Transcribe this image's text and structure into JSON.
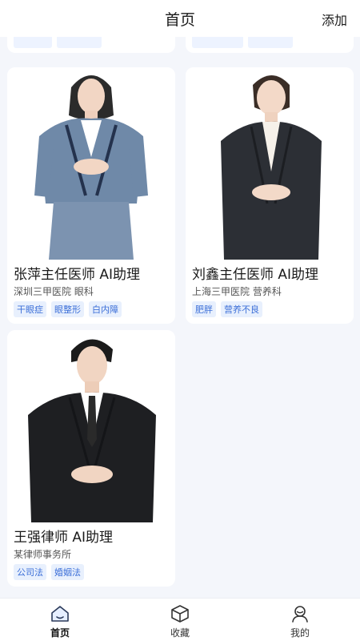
{
  "header": {
    "title": "首页",
    "add_label": "添加"
  },
  "cards": [
    {
      "name": "张萍主任医师 AI助理",
      "org": "深圳三甲医院 眼科",
      "tags": [
        "干眼症",
        "眼整形",
        "白内障"
      ],
      "avatar": "female-doctor-portrait",
      "accent": "#6f89a8"
    },
    {
      "name": "刘鑫主任医师 AI助理",
      "org": "上海三甲医院 营养科",
      "tags": [
        "肥胖",
        "营养不良"
      ],
      "avatar": "female-doctor-portrait",
      "accent": "#2c2f35"
    },
    {
      "name": "王强律师 AI助理",
      "org": "某律师事务所",
      "tags": [
        "公司法",
        "婚姻法"
      ],
      "avatar": "male-lawyer-portrait",
      "accent": "#1e1f22"
    }
  ],
  "tabbar": {
    "items": [
      {
        "label": "首页",
        "icon": "home-icon",
        "active": true
      },
      {
        "label": "收藏",
        "icon": "cube-icon",
        "active": false
      },
      {
        "label": "我的",
        "icon": "user-icon",
        "active": false
      }
    ]
  },
  "colors": {
    "background": "#f4f6fb",
    "tag_bg": "#e8f0fd",
    "tag_text": "#3c6fd8"
  }
}
